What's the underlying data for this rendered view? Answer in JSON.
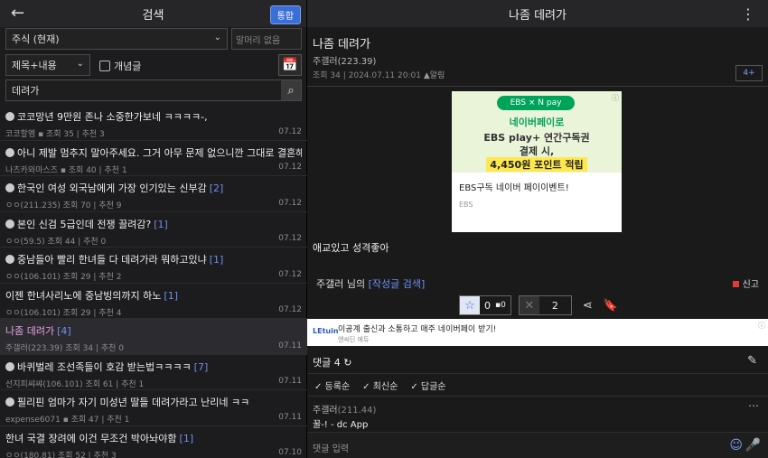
{
  "left": {
    "title": "검색",
    "back_icon": "arrow-left-icon",
    "mode_button": "통합",
    "gallery_select": "주식 (현재)",
    "prefix_select": "말머리 없음",
    "field_select": "제목+내용",
    "recommend_label": "개념글",
    "query": "데려가",
    "items": [
      {
        "title": "코코망년 9만원 존나 소중한가보네 ㅋㅋㅋㅋ-,",
        "count": "",
        "meta": "코코할멤 ▪ 조회 35 | 추천 3",
        "date": "07.12"
      },
      {
        "title": "아니 제발 멈추지 말아주세요. 그거 아무 문제 없으니깐 그대로 결혼해주세",
        "count": "",
        "meta": "나츠카와마스즈 ▪ 조회 40 | 추천 1",
        "date": "07.12"
      },
      {
        "title": "한국인 여성 외국남에게 가장 인기있는 신부감",
        "count": "[2]",
        "meta": "ㅇㅇ(211.235) 조회 70 | 추천 9",
        "date": "07.12"
      },
      {
        "title": "본인 신검 5급인데 전쟁 끌려감?",
        "count": "[1]",
        "meta": "ㅇㅇ(59.5) 조회 44 | 추천 0",
        "date": "07.12"
      },
      {
        "title": "중남들아 빨리 한녀들 다 데려가라 뭐하고있냐",
        "count": "[1]",
        "meta": "ㅇㅇ(106.101) 조회 29 | 추천 2",
        "date": "07.12"
      },
      {
        "title": "이젠 한녀사리노에 중남빙의까지 하노",
        "count": "[1]",
        "meta": "ㅇㅇ(106.101) 조회 29 | 추천 4",
        "date": "07.12"
      },
      {
        "title": "나좀 데려가",
        "count": "[4]",
        "meta": "주갤러(223.39) 조회 34 | 추천 0",
        "date": "07.11"
      },
      {
        "title": "바퀴벌레 조선족들이 호감 받는법ㅋㅋㅋㅋ",
        "count": "[7]",
        "meta": "선지피쌰쌰(106.101) 조회 61 | 추천 1",
        "date": "07.11"
      },
      {
        "title": "필리핀 엄마가 자기 미성년 딸들 데려가라고 난리네 ㅋㅋ",
        "count": "",
        "meta": "expense6071 ▪ 조회 47 | 추천 1",
        "date": "07.11"
      },
      {
        "title": "한녀 국결 장려에 이건 무조건 박아놔야함",
        "count": "[1]",
        "meta": "ㅇㅇ(180.81) 조회 52 | 추천 3",
        "date": "07.10"
      }
    ]
  },
  "right": {
    "title": "나좀 데려가",
    "post_title": "나좀 데려가",
    "author": "주갤러(223.39)",
    "meta": "조회 34 | 2024.07.11 20:01",
    "meta_tag": "알림",
    "count_btn": "4+",
    "ad": {
      "badge": "EBS × N pay",
      "line1": "네이버페이로",
      "line2": "EBS play+ 연간구독권",
      "line3": "결제 시,",
      "line4": "4,450원 포인트 적립",
      "text": "EBS구독 네이버 페이이벤트!",
      "sub": "EBS"
    },
    "body": "애교있고 성격좋아",
    "writer_name": "주갤러",
    "writer_suffix": "님의",
    "writer_link": "[작성글 검색]",
    "report": "신고",
    "up_count": "0",
    "up_sub": "0",
    "down_count": "2",
    "banner": {
      "logo": "LEtuin",
      "title": "이공계 출신과 소통하고 매주 네이버페이 받기!",
      "sub": "엔씨딘 에듀"
    },
    "comment_header": "댓글 4",
    "sort": [
      "✓ 등록순",
      "✓ 최신순",
      "✓ 답글순"
    ],
    "comment_author": "주갤러",
    "comment_ip": "(211.44)",
    "comment_text": "꿀-! - dc App",
    "comment_placeholder": "댓글 입력"
  }
}
